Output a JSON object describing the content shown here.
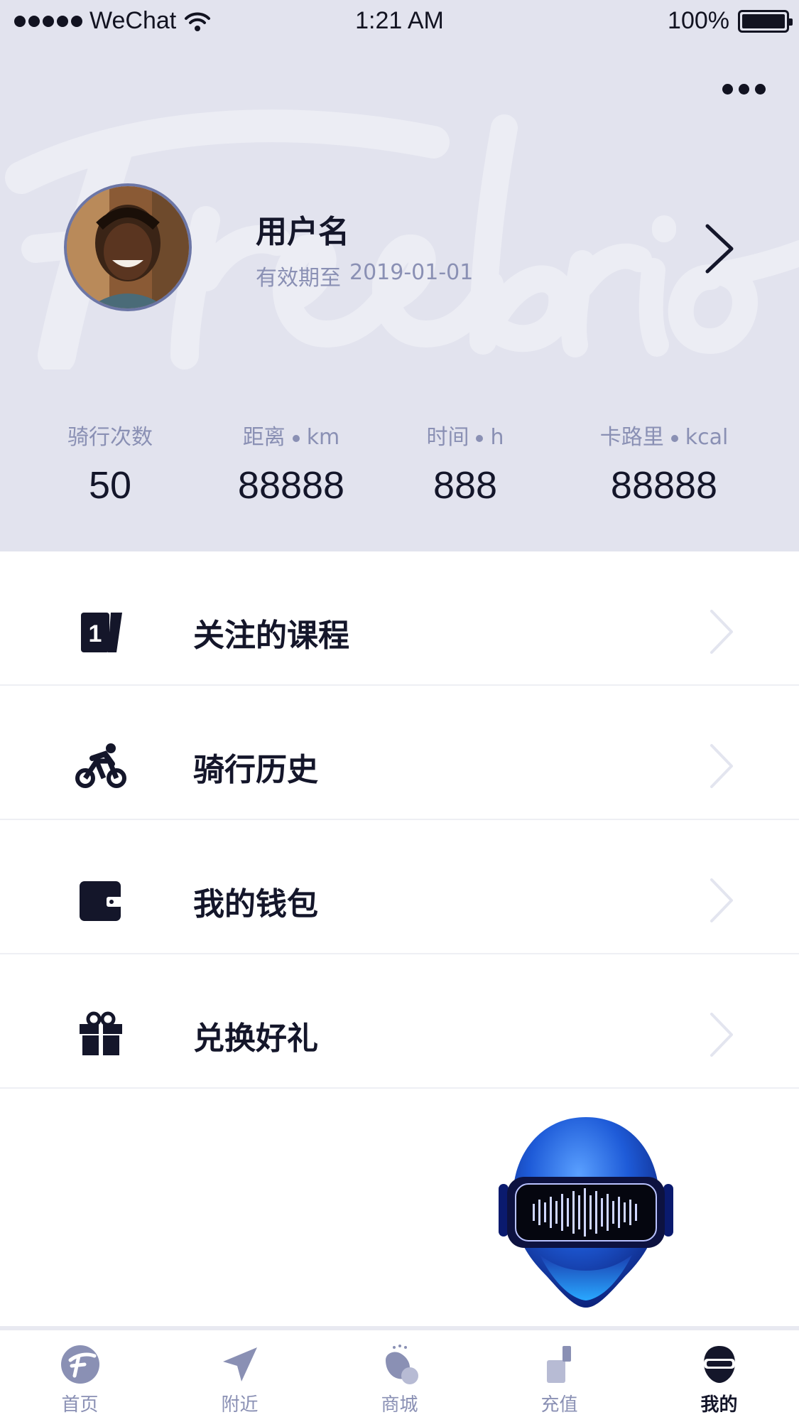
{
  "status_bar": {
    "carrier": "WeChat",
    "time": "1:21 AM",
    "battery": "100%"
  },
  "profile": {
    "username": "用户名",
    "validity_label": "有效期至",
    "validity_date": "2019-01-01",
    "watermark": "Freebrio"
  },
  "stats": [
    {
      "label": "骑行次数",
      "unit": "",
      "value": "50"
    },
    {
      "label": "距离",
      "unit": "km",
      "value": "88888"
    },
    {
      "label": "时间",
      "unit": "h",
      "value": "888"
    },
    {
      "label": "卡路里",
      "unit": "kcal",
      "value": "88888"
    }
  ],
  "menu": [
    {
      "label": "关注的课程",
      "icon": "course-icon"
    },
    {
      "label": "骑行历史",
      "icon": "cycling-icon"
    },
    {
      "label": "我的钱包",
      "icon": "wallet-icon"
    },
    {
      "label": "兑换好礼",
      "icon": "gift-icon"
    }
  ],
  "tabs": [
    {
      "label": "首页",
      "icon": "home-logo-icon",
      "active": false
    },
    {
      "label": "附近",
      "icon": "location-arrow-icon",
      "active": false
    },
    {
      "label": "商城",
      "icon": "shop-icon",
      "active": false
    },
    {
      "label": "充值",
      "icon": "recharge-icon",
      "active": false
    },
    {
      "label": "我的",
      "icon": "helmet-icon",
      "active": true
    }
  ],
  "colors": {
    "header_bg": "#e2e3ee",
    "primary_text": "#14162a",
    "muted_text": "#8a90b4",
    "accent_blue": "#1e5bd8"
  }
}
